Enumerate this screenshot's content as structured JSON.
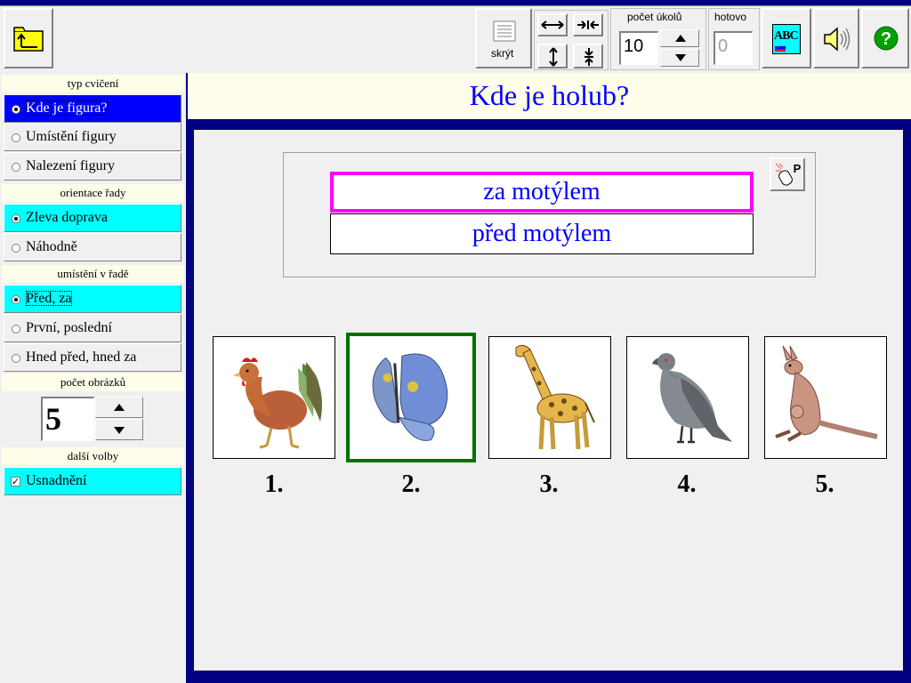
{
  "toolbar": {
    "hide_label": "skrýt",
    "task_count_label": "počet úkolů",
    "task_count_value": "10",
    "done_label": "hotovo",
    "done_value": "0",
    "abc_text": "ABC"
  },
  "sidebar": {
    "exercise_type": {
      "heading": "typ cvičení",
      "options": [
        "Kde je figura?",
        "Umístění figury",
        "Nalezení figury"
      ],
      "selected": 0
    },
    "row_orientation": {
      "heading": "orientace řady",
      "options": [
        "Zleva doprava",
        "Náhodně"
      ],
      "selected": 0
    },
    "row_position": {
      "heading": "umístění v řadě",
      "options": [
        "Před, za",
        "První, poslední",
        "Hned před, hned za"
      ],
      "selected": 0
    },
    "image_count": {
      "heading": "počet obrázků",
      "value": "5"
    },
    "more_options": {
      "heading": "další volby",
      "options": [
        "Usnadnění"
      ],
      "checked": true
    }
  },
  "main": {
    "question": "Kde je holub?",
    "answers": [
      "za motýlem",
      "před motýlem"
    ],
    "answer_selected": 0,
    "cards": [
      {
        "animal": "rooster",
        "label": "1."
      },
      {
        "animal": "butterfly",
        "label": "2.",
        "selected": true
      },
      {
        "animal": "giraffe",
        "label": "3."
      },
      {
        "animal": "pigeon",
        "label": "4."
      },
      {
        "animal": "kangaroo",
        "label": "5."
      }
    ],
    "hint_button_letter": "P"
  },
  "colors": {
    "accent_blue": "#0000ff",
    "highlight_cyan": "#00ffff",
    "answer_border": "#ff00ff",
    "card_selected": "#007000",
    "frame_navy": "#000080"
  }
}
